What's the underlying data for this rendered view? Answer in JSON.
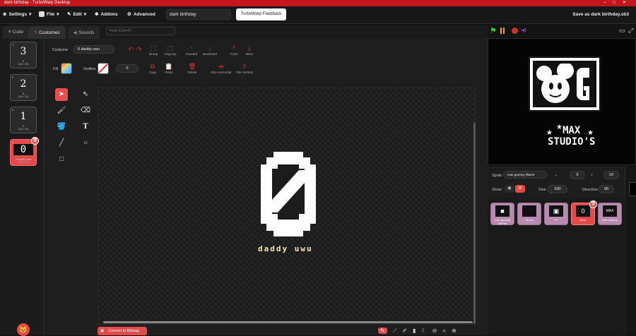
{
  "window": {
    "title": "dark birthday - TurboWarp Desktop"
  },
  "menubar": {
    "settings": "Settings",
    "file": "File",
    "edit": "Edit",
    "addons": "Addons",
    "advanced": "Advanced",
    "project_title": "dark birthday",
    "feedback": "TurboWarp Feedback",
    "save_as": "Save as dark birthday.sb3"
  },
  "tabs": {
    "code": "Code",
    "costumes": "Costumes",
    "sounds": "Sounds",
    "find_placeholder": "Find (Ctrl+F)"
  },
  "costumes": [
    {
      "index": "1",
      "thumb": "3",
      "name": "3",
      "size": "108 x 201"
    },
    {
      "index": "2",
      "thumb": "2",
      "name": "2",
      "size": "108 x 201"
    },
    {
      "index": "3",
      "thumb": "1",
      "name": "1",
      "size": "108 x 201"
    },
    {
      "index": "4",
      "thumb": "0",
      "name": "0 daddy uwu",
      "size": "108 x 201"
    }
  ],
  "toolbar": {
    "costume_label": "Costume",
    "costume_name": "0 daddy uwu",
    "group": "Group",
    "ungroup": "Ungroup",
    "forward": "Forward",
    "backward": "Backward",
    "front": "Front",
    "back": "Back",
    "fill_label": "Fill",
    "outline_label": "Outline",
    "outline_width": "0",
    "copy": "Copy",
    "paste": "Paste",
    "delete": "Delete",
    "flip_h": "Flip Horizontal",
    "flip_v": "Flip Vertical"
  },
  "canvas": {
    "text": "daddy uwu",
    "convert": "Convert to Bitmap"
  },
  "stage": {
    "logo_text": "MAX\nSTUDIO'S"
  },
  "sprite_info": {
    "sprite_label": "Sprite",
    "sprite_name": "max gummy (flame",
    "x": "9",
    "y": "10",
    "show_label": "Show",
    "size_label": "Size",
    "size": "200",
    "direction_label": "Direction",
    "direction": "90"
  },
  "sprites": [
    {
      "name": "max gummy (flame)",
      "thumb": "■"
    },
    {
      "name": "Studio",
      "thumb": ""
    },
    {
      "name": "TV",
      "thumb": "▣"
    },
    {
      "name": "timer",
      "thumb": "0"
    },
    {
      "name": "max studio's",
      "thumb": "MAX"
    }
  ],
  "colors": {
    "accent": "#e34a4a",
    "titlebar": "#c4161c"
  }
}
